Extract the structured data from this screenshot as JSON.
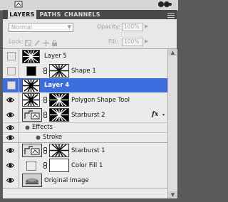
{
  "tabs": [
    "LAYERS",
    "PATHS",
    "CHANNELS"
  ],
  "blend_mode": "Normal",
  "opacity": {
    "label": "Opacity:",
    "value": "100%"
  },
  "lock_label": "Lock:",
  "fill": {
    "label": "Fill:",
    "value": "100%"
  },
  "layers": [
    {
      "name": "Layer 5",
      "visible": false,
      "selected": false
    },
    {
      "name": "Shape 1",
      "visible": false,
      "selected": false
    },
    {
      "name": "Layer 4",
      "visible": false,
      "selected": true
    },
    {
      "name": "Polygon Shape Tool",
      "visible": true,
      "selected": false
    },
    {
      "name": "Starburst 2",
      "visible": true,
      "selected": false,
      "fx": "fx"
    },
    {
      "name": "Effects",
      "visible": true,
      "effect_group": true
    },
    {
      "name": "Stroke",
      "visible": true,
      "effect": true
    },
    {
      "name": "Starburst 1",
      "visible": true,
      "selected": false
    },
    {
      "name": "Color Fill 1",
      "visible": true,
      "selected": false
    },
    {
      "name": "Original Image",
      "visible": true,
      "selected": false
    }
  ],
  "colors": {
    "selection": "#3c6cdd",
    "panel": "#ebebeb",
    "tabbar": "#494949"
  }
}
